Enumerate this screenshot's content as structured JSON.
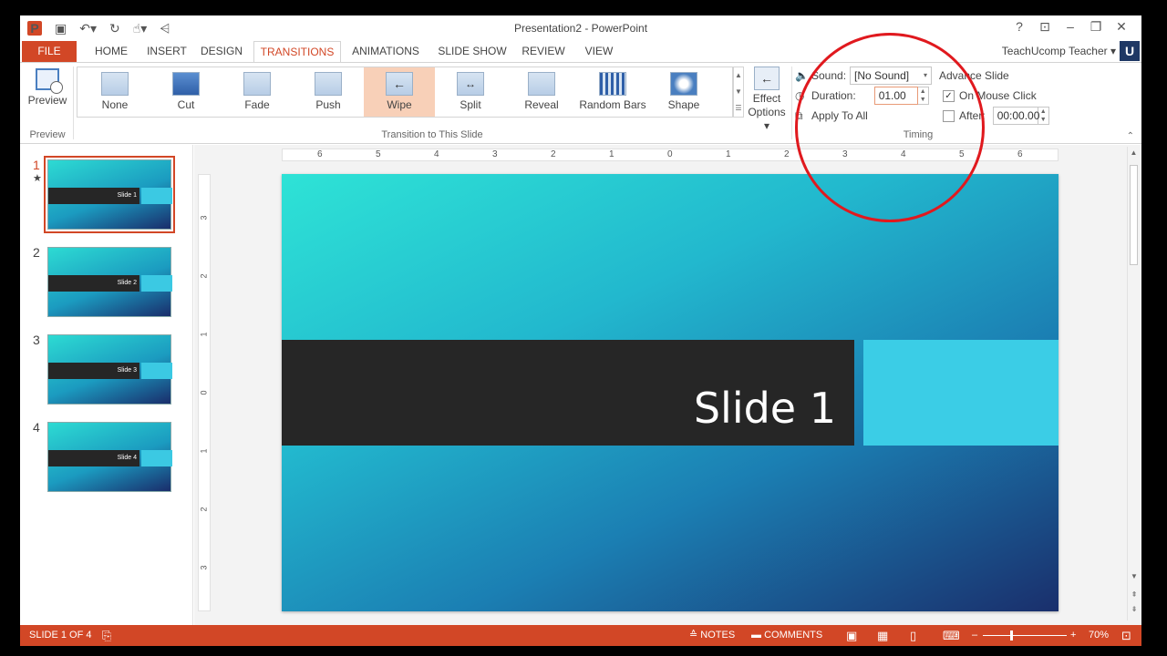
{
  "window": {
    "title": "Presentation2 - PowerPoint",
    "user": "TeachUcomp Teacher",
    "user_badge": "U",
    "controls": [
      "?",
      "⊡",
      "–",
      "❐",
      "✕"
    ]
  },
  "qat": {
    "app_icon": "P"
  },
  "tabs": [
    "FILE",
    "HOME",
    "INSERT",
    "DESIGN",
    "TRANSITIONS",
    "ANIMATIONS",
    "SLIDE SHOW",
    "REVIEW",
    "VIEW"
  ],
  "ribbon": {
    "preview": {
      "label": "Preview",
      "group": "Preview"
    },
    "gallery_group": "Transition to This Slide",
    "transitions": [
      "None",
      "Cut",
      "Fade",
      "Push",
      "Wipe",
      "Split",
      "Reveal",
      "Random Bars",
      "Shape"
    ],
    "active_transition": "Wipe",
    "effect_options": {
      "line1": "Effect",
      "line2": "Options"
    },
    "timing": {
      "group": "Timing",
      "sound_label": "Sound:",
      "sound_value": "[No Sound]",
      "duration_label": "Duration:",
      "duration_value": "01.00",
      "apply_all": "Apply To All",
      "advance_title": "Advance Slide",
      "on_click_label": "On Mouse Click",
      "on_click_checked": true,
      "after_label": "After:",
      "after_value": "00:00.00",
      "after_checked": false
    }
  },
  "thumbnails": [
    {
      "num": "1",
      "label": "Slide 1",
      "selected": true
    },
    {
      "num": "2",
      "label": "Slide 2",
      "selected": false
    },
    {
      "num": "3",
      "label": "Slide 3",
      "selected": false
    },
    {
      "num": "4",
      "label": "Slide 4",
      "selected": false
    }
  ],
  "thumb_star": "★",
  "ruler_h": [
    "6",
    "5",
    "4",
    "3",
    "2",
    "1",
    "0",
    "1",
    "2",
    "3",
    "4",
    "5",
    "6"
  ],
  "ruler_v": [
    "3",
    "2",
    "1",
    "0",
    "1",
    "2",
    "3"
  ],
  "slide": {
    "title": "Slide 1"
  },
  "status": {
    "slide_info": "SLIDE 1 OF 4",
    "notes": "NOTES",
    "comments": "COMMENTS",
    "zoom": "70%"
  },
  "colors": {
    "accent": "#d24726",
    "annotation": "#e0191e"
  }
}
